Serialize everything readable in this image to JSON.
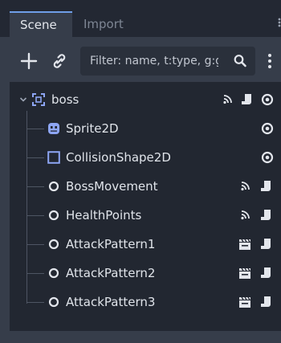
{
  "tabs": [
    {
      "label": "Scene",
      "active": true
    },
    {
      "label": "Import",
      "active": false
    }
  ],
  "toolbar": {
    "filter_placeholder": "Filter: name, t:type, g:group"
  },
  "tree": {
    "root": {
      "label": "boss",
      "icon": "node2d-icon",
      "indicators": [
        "signal-icon",
        "script-icon",
        "visibility-eye-icon"
      ]
    },
    "children": [
      {
        "label": "Sprite2D",
        "icon": "sprite2d-icon",
        "indicators": [
          "visibility-eye-icon"
        ]
      },
      {
        "label": "CollisionShape2D",
        "icon": "collision-shape-icon",
        "indicators": [
          "visibility-eye-icon"
        ]
      },
      {
        "label": "BossMovement",
        "icon": "node-circle-icon",
        "indicators": [
          "signal-icon",
          "script-icon"
        ]
      },
      {
        "label": "HealthPoints",
        "icon": "node-circle-icon",
        "indicators": [
          "signal-icon",
          "script-icon"
        ]
      },
      {
        "label": "AttackPattern1",
        "icon": "node-circle-icon",
        "indicators": [
          "clapperboard-icon",
          "script-icon"
        ]
      },
      {
        "label": "AttackPattern2",
        "icon": "node-circle-icon",
        "indicators": [
          "clapperboard-icon",
          "script-icon"
        ]
      },
      {
        "label": "AttackPattern3",
        "icon": "node-circle-icon",
        "indicators": [
          "clapperboard-icon",
          "script-icon"
        ]
      }
    ]
  },
  "colors": {
    "accent": "#6f9ee8",
    "node2d": "#8da5f3",
    "panel": "#222731"
  }
}
